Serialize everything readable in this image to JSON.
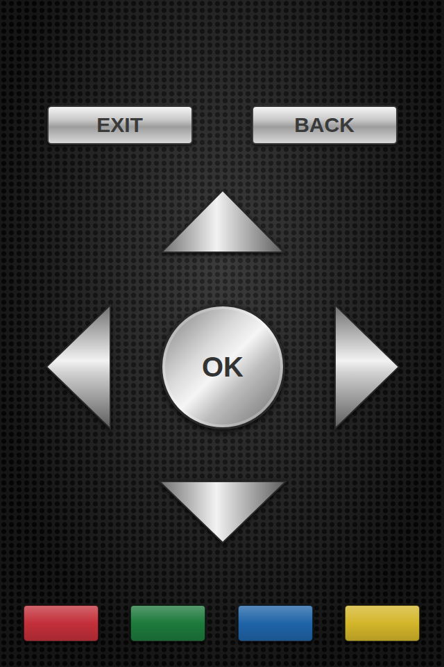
{
  "top_buttons": [
    {
      "label": "EXIT"
    },
    {
      "label": "BACK"
    }
  ],
  "dpad": {
    "center": "OK"
  },
  "color_keys": [
    {
      "color": "#c3303a"
    },
    {
      "color": "#1d7a3c"
    },
    {
      "color": "#1f64a8"
    },
    {
      "color": "#d4b62a"
    }
  ]
}
